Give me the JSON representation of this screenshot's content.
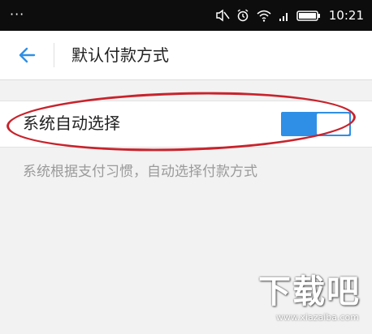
{
  "status_bar": {
    "menu_dots": "···",
    "time": "10:21",
    "icons": [
      "mute-icon",
      "alarm-icon",
      "wifi-icon",
      "signal-icon",
      "battery-icon"
    ]
  },
  "header": {
    "title": "默认付款方式",
    "back_icon": "back-arrow-icon"
  },
  "setting": {
    "label": "系统自动选择",
    "toggle_state": "on"
  },
  "description": "系统根据支付习惯，自动选择付款方式",
  "watermark": {
    "logo": "下载吧",
    "url": "www.xiazaiba.com"
  },
  "colors": {
    "accent": "#2f8fe6",
    "annotation": "#c8232c",
    "status_bar_bg": "#0d0d0d",
    "page_bg": "#f2f2f2"
  }
}
